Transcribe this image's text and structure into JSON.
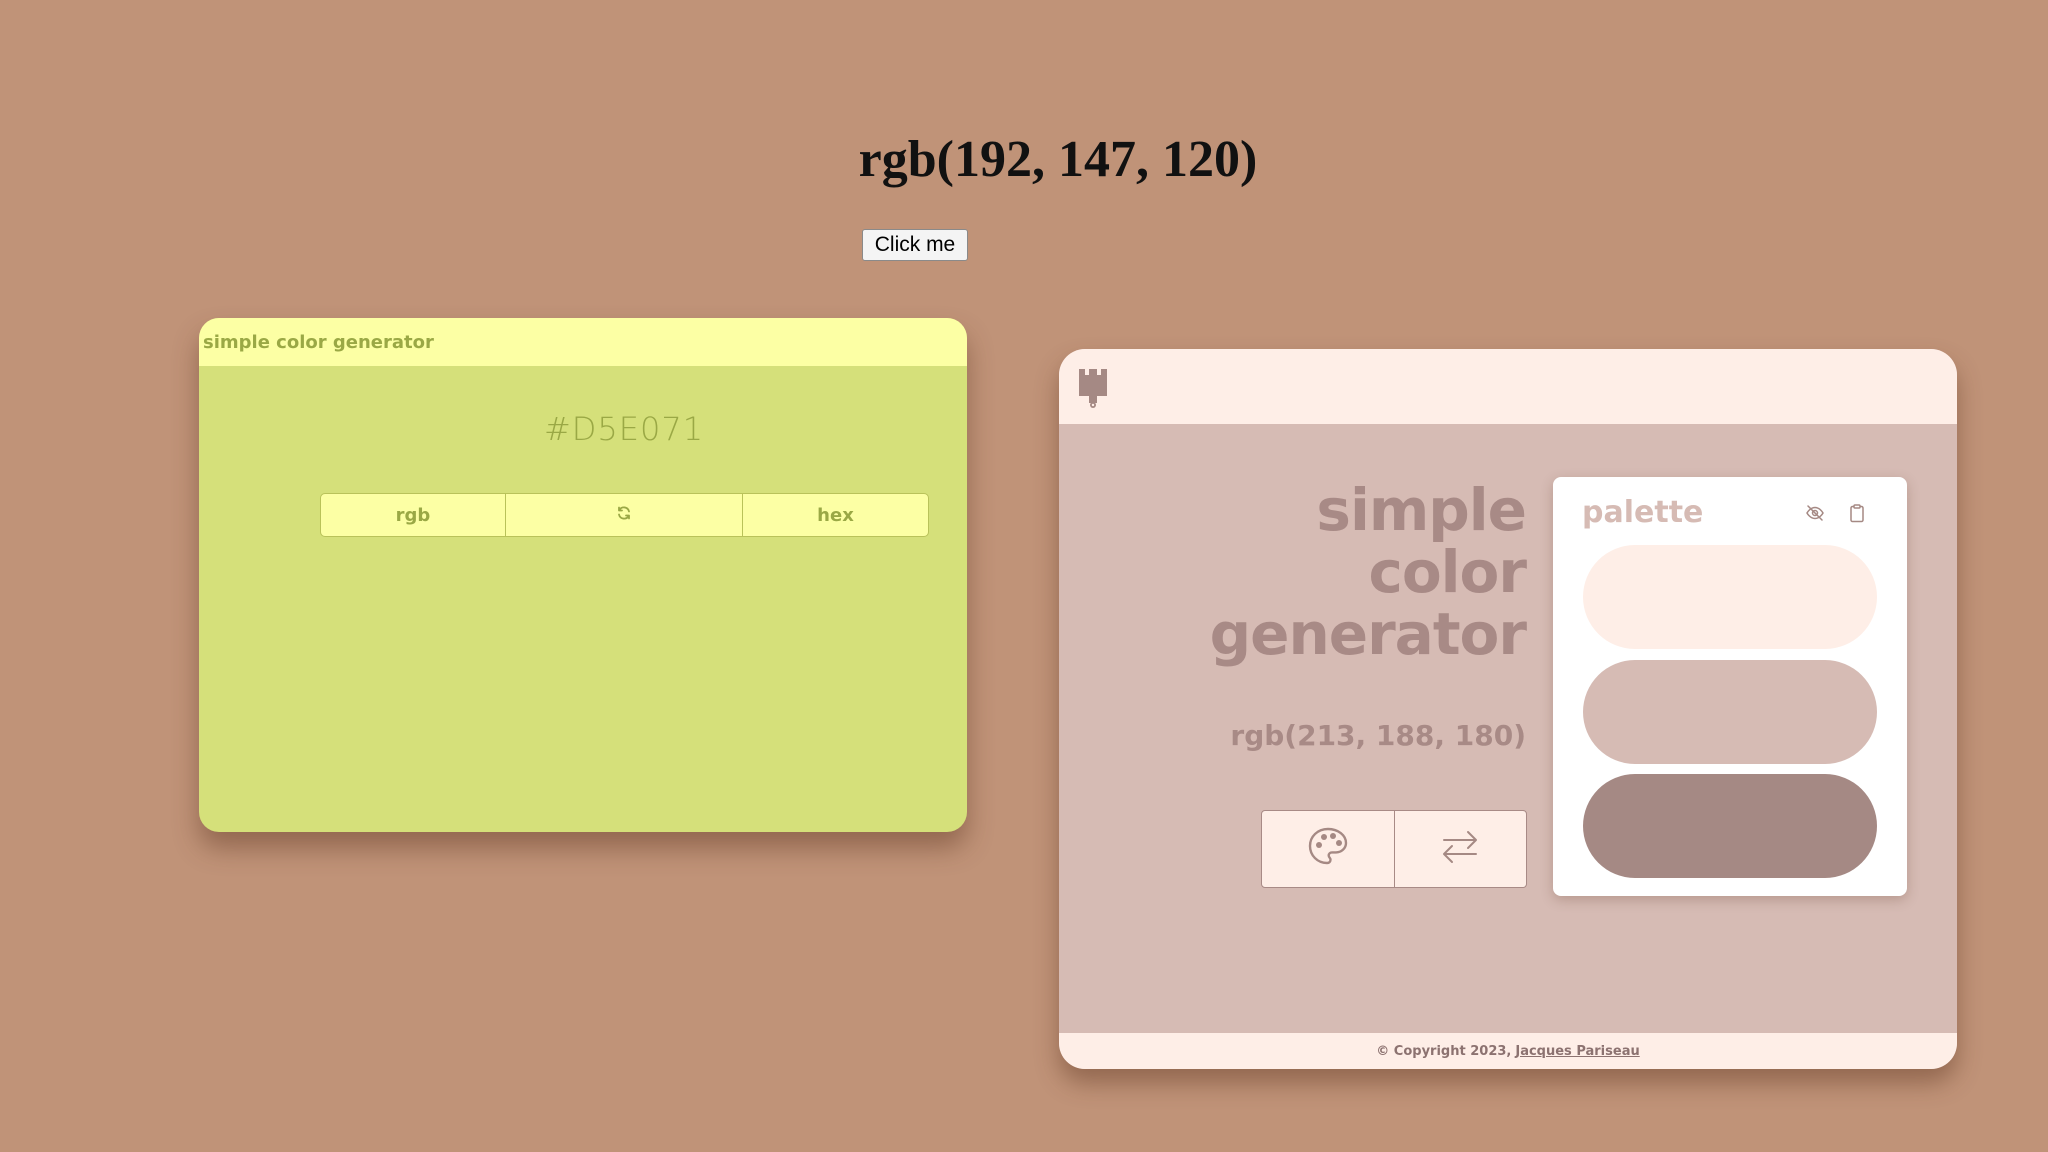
{
  "header": {
    "title": "rgb(192, 147, 120)",
    "button_label": "Click me"
  },
  "left_card": {
    "title": "simple color generator",
    "hex_value": "#D5E071",
    "buttons": {
      "rgb": "rgb",
      "refresh": "refresh-icon",
      "hex": "hex"
    }
  },
  "right_card": {
    "logo": "paintbrush-icon",
    "title_lines": [
      "simple",
      "color",
      "generator"
    ],
    "rgb_value": "rgb(213, 188, 180)",
    "buttons": [
      "palette-icon",
      "swap-arrows-icon"
    ],
    "palette": {
      "title": "palette",
      "icons": [
        "eye-slash-icon",
        "clipboard-icon"
      ],
      "swatches": [
        "#FEEEE7",
        "#D6BBB4",
        "#A58984"
      ]
    },
    "footer": {
      "copyright": "© Copyright 2023,",
      "author": "Jacques Pariseau"
    }
  },
  "colors": {
    "page_background": "#C09378",
    "left_card_bg": "#D5E07A",
    "left_card_bar": "#FCFFA4",
    "left_card_text": "#9AA845",
    "right_card_bg": "#D6BBB4",
    "right_card_bar": "#FEEEE7",
    "right_card_text": "#A88A86"
  }
}
